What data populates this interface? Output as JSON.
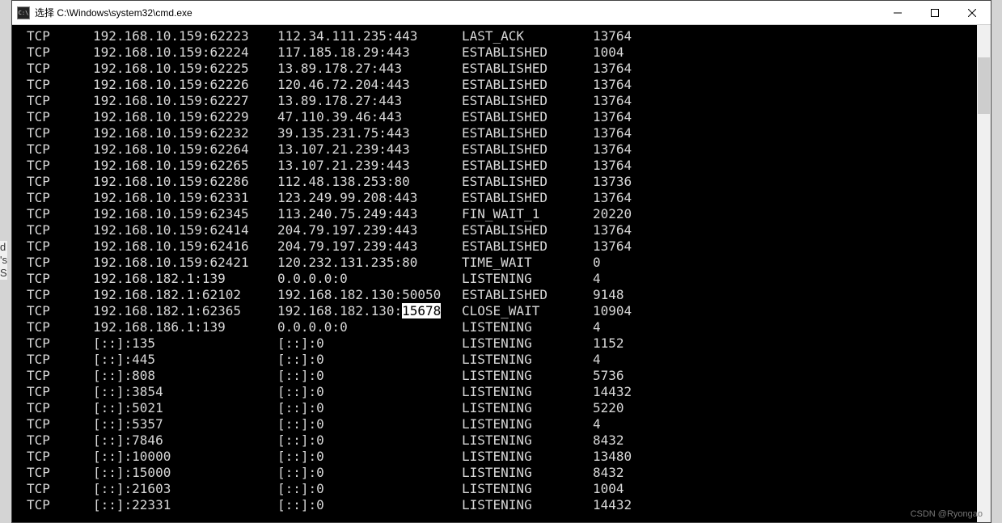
{
  "window": {
    "title": "选择 C:\\Windows\\system32\\cmd.exe"
  },
  "watermark": "CSDN @Ryongao",
  "edge_chars": [
    "d",
    "'s",
    "S"
  ],
  "highlight": {
    "row_index": 17,
    "text": "15678"
  },
  "connections": [
    {
      "proto": "TCP",
      "local": "192.168.10.159:62223",
      "remote": "112.34.111.235:443",
      "state": "LAST_ACK",
      "pid": "13764"
    },
    {
      "proto": "TCP",
      "local": "192.168.10.159:62224",
      "remote": "117.185.18.29:443",
      "state": "ESTABLISHED",
      "pid": "1004"
    },
    {
      "proto": "TCP",
      "local": "192.168.10.159:62225",
      "remote": "13.89.178.27:443",
      "state": "ESTABLISHED",
      "pid": "13764"
    },
    {
      "proto": "TCP",
      "local": "192.168.10.159:62226",
      "remote": "120.46.72.204:443",
      "state": "ESTABLISHED",
      "pid": "13764"
    },
    {
      "proto": "TCP",
      "local": "192.168.10.159:62227",
      "remote": "13.89.178.27:443",
      "state": "ESTABLISHED",
      "pid": "13764"
    },
    {
      "proto": "TCP",
      "local": "192.168.10.159:62229",
      "remote": "47.110.39.46:443",
      "state": "ESTABLISHED",
      "pid": "13764"
    },
    {
      "proto": "TCP",
      "local": "192.168.10.159:62232",
      "remote": "39.135.231.75:443",
      "state": "ESTABLISHED",
      "pid": "13764"
    },
    {
      "proto": "TCP",
      "local": "192.168.10.159:62264",
      "remote": "13.107.21.239:443",
      "state": "ESTABLISHED",
      "pid": "13764"
    },
    {
      "proto": "TCP",
      "local": "192.168.10.159:62265",
      "remote": "13.107.21.239:443",
      "state": "ESTABLISHED",
      "pid": "13764"
    },
    {
      "proto": "TCP",
      "local": "192.168.10.159:62286",
      "remote": "112.48.138.253:80",
      "state": "ESTABLISHED",
      "pid": "13736"
    },
    {
      "proto": "TCP",
      "local": "192.168.10.159:62331",
      "remote": "123.249.99.208:443",
      "state": "ESTABLISHED",
      "pid": "13764"
    },
    {
      "proto": "TCP",
      "local": "192.168.10.159:62345",
      "remote": "113.240.75.249:443",
      "state": "FIN_WAIT_1",
      "pid": "20220"
    },
    {
      "proto": "TCP",
      "local": "192.168.10.159:62414",
      "remote": "204.79.197.239:443",
      "state": "ESTABLISHED",
      "pid": "13764"
    },
    {
      "proto": "TCP",
      "local": "192.168.10.159:62416",
      "remote": "204.79.197.239:443",
      "state": "ESTABLISHED",
      "pid": "13764"
    },
    {
      "proto": "TCP",
      "local": "192.168.10.159:62421",
      "remote": "120.232.131.235:80",
      "state": "TIME_WAIT",
      "pid": "0"
    },
    {
      "proto": "TCP",
      "local": "192.168.182.1:139",
      "remote": "0.0.0.0:0",
      "state": "LISTENING",
      "pid": "4"
    },
    {
      "proto": "TCP",
      "local": "192.168.182.1:62102",
      "remote": "192.168.182.130:50050",
      "state": "ESTABLISHED",
      "pid": "9148"
    },
    {
      "proto": "TCP",
      "local": "192.168.182.1:62365",
      "remote_prefix": "192.168.182.130:",
      "remote_hl": "15678",
      "state": "CLOSE_WAIT",
      "pid": "10904"
    },
    {
      "proto": "TCP",
      "local": "192.168.186.1:139",
      "remote": "0.0.0.0:0",
      "state": "LISTENING",
      "pid": "4"
    },
    {
      "proto": "TCP",
      "local": "[::]:135",
      "remote": "[::]:0",
      "state": "LISTENING",
      "pid": "1152"
    },
    {
      "proto": "TCP",
      "local": "[::]:445",
      "remote": "[::]:0",
      "state": "LISTENING",
      "pid": "4"
    },
    {
      "proto": "TCP",
      "local": "[::]:808",
      "remote": "[::]:0",
      "state": "LISTENING",
      "pid": "5736"
    },
    {
      "proto": "TCP",
      "local": "[::]:3854",
      "remote": "[::]:0",
      "state": "LISTENING",
      "pid": "14432"
    },
    {
      "proto": "TCP",
      "local": "[::]:5021",
      "remote": "[::]:0",
      "state": "LISTENING",
      "pid": "5220"
    },
    {
      "proto": "TCP",
      "local": "[::]:5357",
      "remote": "[::]:0",
      "state": "LISTENING",
      "pid": "4"
    },
    {
      "proto": "TCP",
      "local": "[::]:7846",
      "remote": "[::]:0",
      "state": "LISTENING",
      "pid": "8432"
    },
    {
      "proto": "TCP",
      "local": "[::]:10000",
      "remote": "[::]:0",
      "state": "LISTENING",
      "pid": "13480"
    },
    {
      "proto": "TCP",
      "local": "[::]:15000",
      "remote": "[::]:0",
      "state": "LISTENING",
      "pid": "8432"
    },
    {
      "proto": "TCP",
      "local": "[::]:21603",
      "remote": "[::]:0",
      "state": "LISTENING",
      "pid": "1004"
    },
    {
      "proto": "TCP",
      "local": "[::]:22331",
      "remote": "[::]:0",
      "state": "LISTENING",
      "pid": "14432"
    }
  ]
}
